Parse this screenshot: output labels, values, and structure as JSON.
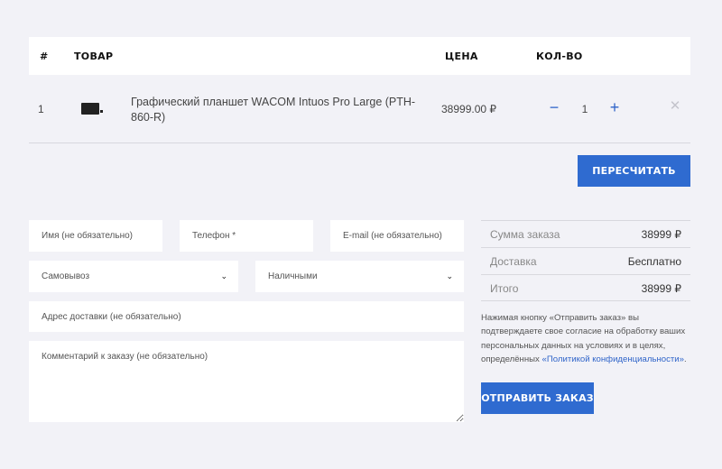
{
  "cart": {
    "columns": {
      "num": "#",
      "product": "ТОВАР",
      "price": "ЦЕНА",
      "qty": "КОЛ-ВО"
    },
    "items": [
      {
        "num": "1",
        "name": "Графический планшет WACOM Intuos Pro Large (PTH-860-R)",
        "price": "38999.00 ₽",
        "qty": "1",
        "thumb_icon": "tablet-thumbnail"
      }
    ],
    "icons": {
      "minus": "−",
      "plus": "+",
      "remove": "✕"
    },
    "recalc_label": "ПЕРЕСЧИТАТЬ"
  },
  "form": {
    "name_placeholder": "Имя (не обязательно)",
    "phone_placeholder": "Телефон *",
    "email_placeholder": "E-mail (не обязательно)",
    "delivery_selected": "Самовывоз",
    "payment_selected": "Наличными",
    "address_placeholder": "Адрес доставки (не обязательно)",
    "comment_placeholder": "Комментарий к заказу (не обязательно)",
    "chevron": "⌄"
  },
  "summary": {
    "order_total_label": "Сумма заказа",
    "order_total_value": "38999 ₽",
    "delivery_label": "Доставка",
    "delivery_value": "Бесплатно",
    "total_label": "Итого",
    "total_value": "38999 ₽"
  },
  "consent": {
    "text": "Нажимая кнопку «Отправить заказ» вы подтверждаете свое согласие на обработку ваших персональных данных на условиях и в целях, определённых ",
    "link": "«Политикой конфиденциальности»",
    "end": "."
  },
  "submit_label": "ОТПРАВИТЬ ЗАКАЗ",
  "colors": {
    "accent": "#2f6bd0",
    "background": "#f2f2f7"
  }
}
